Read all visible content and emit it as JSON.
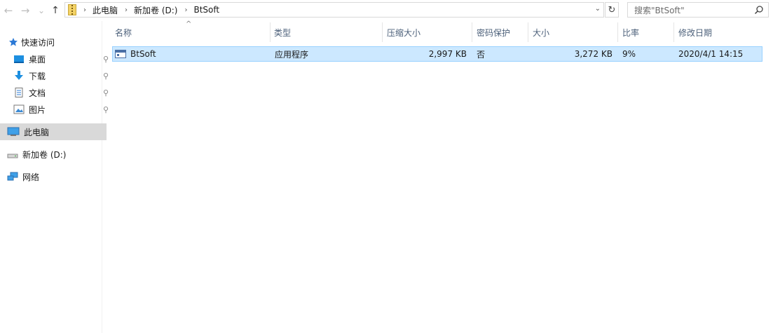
{
  "nav": {
    "back": "←",
    "forward": "→",
    "recent": "⌄",
    "up": "↑"
  },
  "address": {
    "crumbs": [
      "此电脑",
      "新加卷 (D:)",
      "BtSoft"
    ],
    "dropdown": "⌄",
    "refresh": "↻"
  },
  "search": {
    "placeholder": "搜索\"BtSoft\""
  },
  "sidebar": {
    "quick_access": "快速访问",
    "items": [
      {
        "label": "桌面",
        "icon": "desktop-icon",
        "pinned": true
      },
      {
        "label": "下载",
        "icon": "download-icon",
        "pinned": true
      },
      {
        "label": "文档",
        "icon": "document-icon",
        "pinned": true
      },
      {
        "label": "图片",
        "icon": "picture-icon",
        "pinned": true
      }
    ],
    "this_pc": "此电脑",
    "drive": "新加卷 (D:)",
    "network": "网络",
    "pin_glyph": "📌"
  },
  "columns": [
    "名称",
    "类型",
    "压缩大小",
    "密码保护",
    "大小",
    "比率",
    "修改日期"
  ],
  "sort_caret": "^",
  "files": [
    {
      "name": "BtSoft",
      "type": "应用程序",
      "compressed_size": "2,997 KB",
      "password": "否",
      "size": "3,272 KB",
      "ratio": "9%",
      "modified": "2020/4/1 14:15"
    }
  ],
  "colors": {
    "selection_bg": "#cce8ff",
    "selection_border": "#99d1ff",
    "header_text": "#4c607a"
  }
}
